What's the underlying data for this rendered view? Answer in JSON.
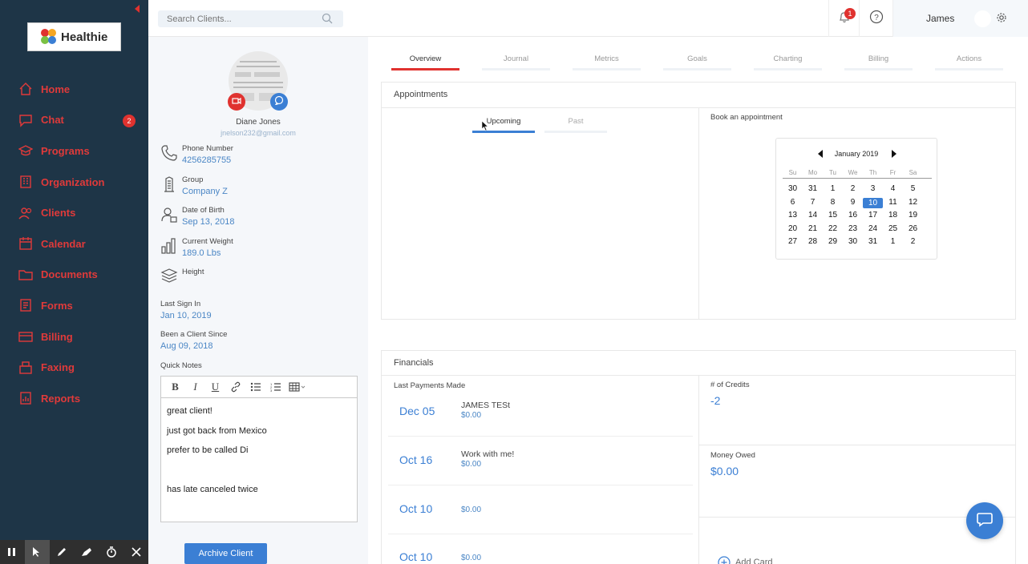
{
  "brand": {
    "name": "Healthie"
  },
  "nav": {
    "items": [
      {
        "label": "Home",
        "icon": "home-icon"
      },
      {
        "label": "Chat",
        "icon": "chat-icon",
        "badge": "2"
      },
      {
        "label": "Programs",
        "icon": "graduation-cap-icon"
      },
      {
        "label": "Organization",
        "icon": "building-icon"
      },
      {
        "label": "Clients",
        "icon": "users-icon"
      },
      {
        "label": "Calendar",
        "icon": "calendar-icon"
      },
      {
        "label": "Documents",
        "icon": "folder-icon"
      },
      {
        "label": "Forms",
        "icon": "form-icon"
      },
      {
        "label": "Billing",
        "icon": "billing-icon"
      },
      {
        "label": "Faxing",
        "icon": "fax-icon"
      },
      {
        "label": "Reports",
        "icon": "reports-icon"
      }
    ]
  },
  "topbar": {
    "search_placeholder": "Search Clients...",
    "notification_count": "1",
    "user_name": "James"
  },
  "client": {
    "name": "Diane Jones",
    "email": "jnelson232@gmail.com",
    "phone_label": "Phone Number",
    "phone": "4256285755",
    "group_label": "Group",
    "group": "Company Z",
    "dob_label": "Date of Birth",
    "dob": "Sep 13, 2018",
    "weight_label": "Current Weight",
    "weight": "189.0 Lbs",
    "height_label": "Height",
    "last_sign_in_label": "Last Sign In",
    "last_sign_in": "Jan 10, 2019",
    "client_since_label": "Been a Client Since",
    "client_since": "Aug 09, 2018",
    "notes_label": "Quick Notes",
    "notes": [
      "great client!",
      "just got back from Mexico",
      "prefer to be called Di",
      "",
      "has late canceled twice"
    ],
    "archive_label": "Archive Client"
  },
  "tabs": [
    "Overview",
    "Journal",
    "Metrics",
    "Goals",
    "Charting",
    "Billing",
    "Actions"
  ],
  "appointments": {
    "title": "Appointments",
    "subtabs": [
      "Upcoming",
      "Past"
    ],
    "book_label": "Book an appointment",
    "calendar": {
      "month": "January 2019",
      "dow": [
        "Su",
        "Mo",
        "Tu",
        "We",
        "Th",
        "Fr",
        "Sa"
      ],
      "weeks": [
        [
          "30",
          "31",
          "1",
          "2",
          "3",
          "4",
          "5"
        ],
        [
          "6",
          "7",
          "8",
          "9",
          "10",
          "11",
          "12"
        ],
        [
          "13",
          "14",
          "15",
          "16",
          "17",
          "18",
          "19"
        ],
        [
          "20",
          "21",
          "22",
          "23",
          "24",
          "25",
          "26"
        ],
        [
          "27",
          "28",
          "29",
          "30",
          "31",
          "1",
          "2"
        ]
      ],
      "today": "10"
    }
  },
  "financials": {
    "title": "Financials",
    "payments_label": "Last Payments Made",
    "payments": [
      {
        "date": "Dec 05",
        "name": "JAMES TESt",
        "amount": "$0.00"
      },
      {
        "date": "Oct 16",
        "name": "Work with me!",
        "amount": "$0.00"
      },
      {
        "date": "Oct 10",
        "name": "",
        "amount": "$0.00"
      },
      {
        "date": "Oct 10",
        "name": "",
        "amount": "$0.00"
      }
    ],
    "credits_label": "# of Credits",
    "credits": "-2",
    "owed_label": "Money Owed",
    "owed": "$0.00",
    "add_card_label": "Add Card"
  },
  "colors": {
    "sidebar": "#1e3547",
    "accent_red": "#e0322f",
    "accent_blue": "#3b7fd4"
  }
}
